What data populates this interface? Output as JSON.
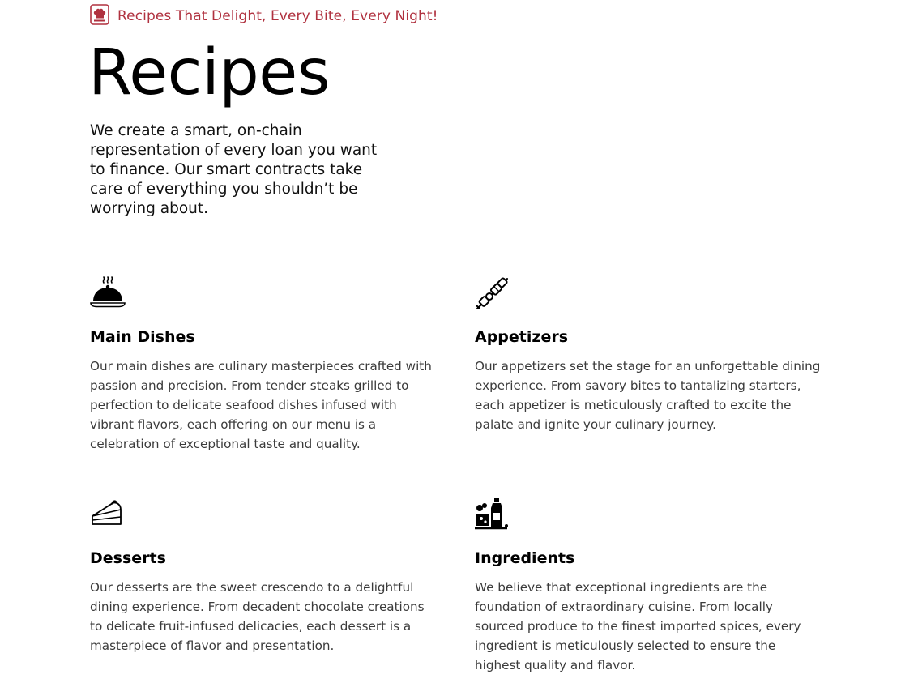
{
  "theme": {
    "accent": "#b0313f"
  },
  "header": {
    "tagline": "Recipes That Delight, Every Bite, Every Night!",
    "tagline_icon": "chef-hat-icon",
    "title": "Recipes",
    "intro": "We create a smart, on-chain representation of every loan you want to finance. Our smart contracts take care of everything you shouldn’t be worrying about."
  },
  "categories": [
    {
      "icon": "cloche-icon",
      "title": "Main Dishes",
      "description": "Our main dishes are culinary masterpieces crafted with passion and precision. From tender steaks grilled to perfection to delicate seafood dishes infused with vibrant flavors, each offering on our menu is a celebration of exceptional taste and quality."
    },
    {
      "icon": "skewer-icon",
      "title": "Appetizers",
      "description": "Our appetizers set the stage for an unforgettable dining experience. From savory bites to tantalizing starters, each appetizer is meticulously crafted to excite the palate and ignite your culinary journey."
    },
    {
      "icon": "cake-slice-icon",
      "title": "Desserts",
      "description": "Our desserts are the sweet crescendo to a delightful dining experience. From decadent chocolate creations to delicate fruit-infused delicacies, each dessert is a masterpiece of flavor and presentation."
    },
    {
      "icon": "ingredients-icon",
      "title": "Ingredients",
      "description": "We believe that exceptional ingredients are the foundation of extraordinary cuisine. From locally sourced produce to the finest imported spices, every ingredient is meticulously selected to ensure the highest quality and flavor."
    }
  ]
}
